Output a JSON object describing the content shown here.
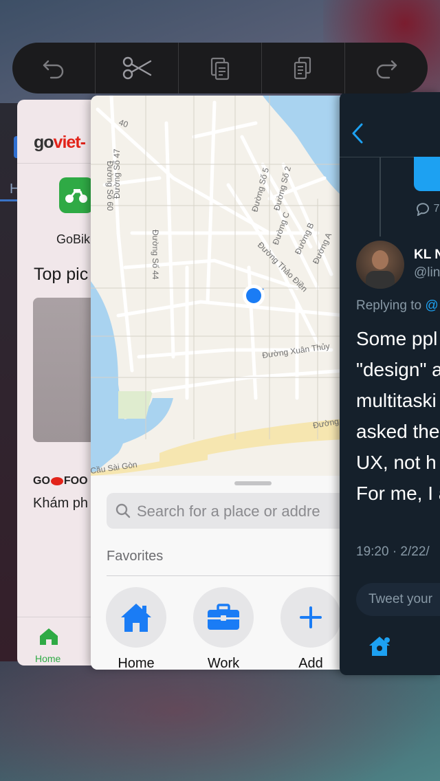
{
  "toolbar": {
    "buttons": [
      {
        "icon": "undo-icon"
      },
      {
        "icon": "scissors-icon"
      },
      {
        "icon": "copy-icon"
      },
      {
        "icon": "paste-icon"
      },
      {
        "icon": "redo-icon"
      }
    ]
  },
  "left_card": {
    "tab_letter": "H"
  },
  "goviet": {
    "logo_go": "go",
    "logo_viet": "viet-",
    "service_label": "GoBik",
    "section_title": "Top pic",
    "food_brand_prefix": "GO",
    "food_brand_suffix": "FOO",
    "explore_text": "Khám ph",
    "tab_home": "Home",
    "brand_green": "#2faa45",
    "brand_red": "#e2231a"
  },
  "maps": {
    "street_labels": [
      "40",
      "Đường Số 60",
      "Đường Số 47",
      "Đường Số 5",
      "Đường Số 2",
      "Đường C",
      "Đường B",
      "Đường A",
      "Đường Số 44",
      "Đường Thảo Điền",
      "Đường Xuân Thủy",
      "Đường",
      "Cầu Sài Gòn"
    ],
    "search_placeholder": "Search for a place or addre",
    "favorites_label": "Favorites",
    "favorites": [
      {
        "label": "Home",
        "icon": "house-icon"
      },
      {
        "label": "Work",
        "icon": "briefcase-icon"
      },
      {
        "label": "Add",
        "icon": "plus-icon"
      }
    ],
    "accent": "#1a7cf5"
  },
  "twitter": {
    "reply_count": "7",
    "display_name": "KL N",
    "handle": "@lin",
    "replying_prefix": "Replying to",
    "replying_at": "@",
    "body_lines": [
      "Some ppl",
      "\"design\" a",
      "multitaski",
      "asked the",
      "UX, not h",
      "For me, I a"
    ],
    "timestamp": "19:20 · 2/22/",
    "compose_placeholder": "Tweet your",
    "accent": "#1da1f2",
    "background": "#15202b"
  }
}
